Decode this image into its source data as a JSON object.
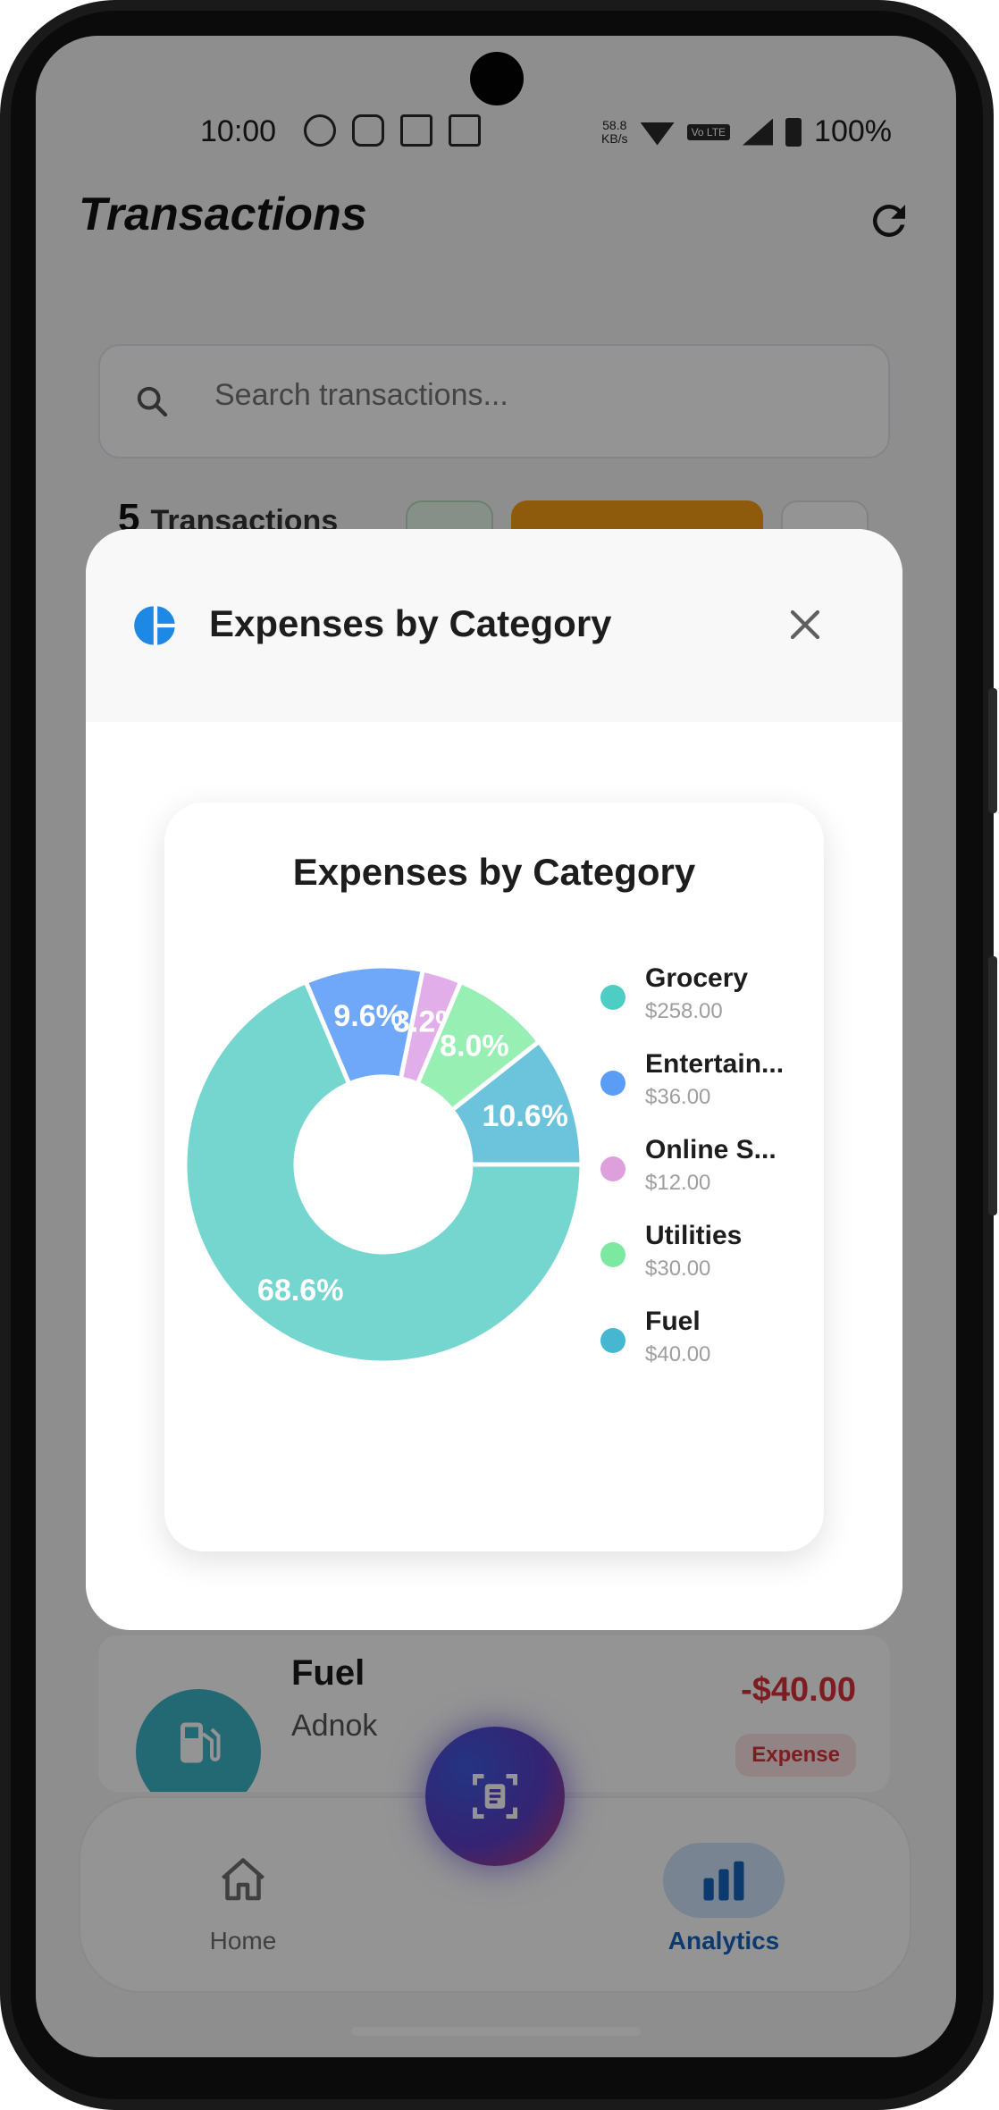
{
  "status_bar": {
    "time": "10:00",
    "network_speed_value": "58.8",
    "network_speed_unit": "KB/s",
    "volte": "Vo LTE",
    "battery": "100%"
  },
  "header": {
    "title": "Transactions",
    "refresh_icon": "refresh-icon"
  },
  "search": {
    "placeholder": "Search transactions...",
    "icon": "search-icon"
  },
  "summary": {
    "count": "5",
    "label": "Transactions"
  },
  "transaction": {
    "title": "Fuel",
    "subtitle": "Adnok",
    "amount": "-$40.00",
    "badge": "Expense",
    "icon": "fuel-pump-icon"
  },
  "nav": {
    "home_label": "Home",
    "analytics_label": "Analytics",
    "fab_icon": "scan-receipt-icon"
  },
  "modal": {
    "title": "Expenses by Category",
    "icon": "pie-chart-icon",
    "close_icon": "close-icon"
  },
  "chart_data": {
    "type": "pie",
    "title": "Expenses by Category",
    "donut": true,
    "categories": [
      "Grocery",
      "Entertain...",
      "Online S...",
      "Utilities",
      "Fuel"
    ],
    "amounts": [
      "$258.00",
      "$36.00",
      "$12.00",
      "$30.00",
      "$40.00"
    ],
    "values": [
      258,
      36,
      12,
      30,
      40
    ],
    "percent_labels": [
      "68.6%",
      "9.6%",
      "3.2%",
      "8.0%",
      "10.6%"
    ],
    "colors": [
      "#75d6cf",
      "#6fa8f8",
      "#e2aeea",
      "#98efb3",
      "#6cc3dc"
    ],
    "legend_dot_colors": [
      "#4ecdc4",
      "#5b9cf6",
      "#dda0dd",
      "#7de8a0",
      "#45b7d1"
    ],
    "legend_position": "right"
  }
}
